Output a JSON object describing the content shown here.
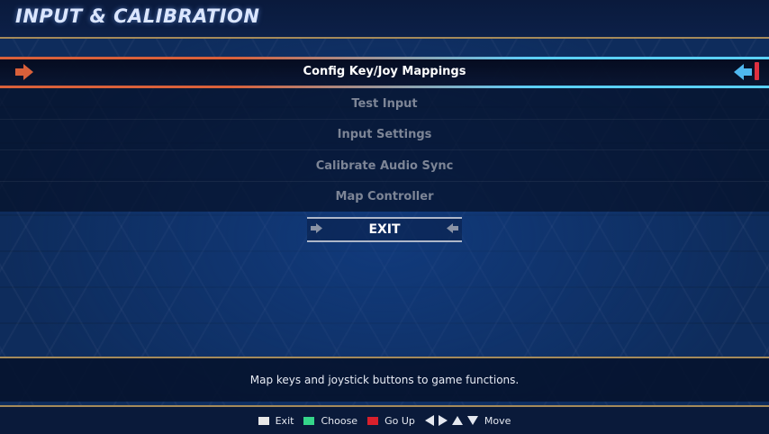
{
  "header": {
    "title": "INPUT & CALIBRATION"
  },
  "menu": {
    "items": [
      {
        "label": "Config Key/Joy Mappings",
        "selected": true
      },
      {
        "label": "Test Input",
        "selected": false
      },
      {
        "label": "Input Settings",
        "selected": false
      },
      {
        "label": "Calibrate Audio Sync",
        "selected": false
      },
      {
        "label": "Map Controller",
        "selected": false
      }
    ],
    "exit_label": "EXIT"
  },
  "description": "Map keys and joystick buttons to game functions.",
  "footer": {
    "exit": "Exit",
    "choose": "Choose",
    "go_up": "Go Up",
    "move": "Move"
  },
  "colors": {
    "exit_key": "#e8e8e8",
    "choose_key": "#35d68a",
    "go_up_key": "#d8202c",
    "accent_left": "#d9603a",
    "accent_right": "#5ad0ff"
  }
}
